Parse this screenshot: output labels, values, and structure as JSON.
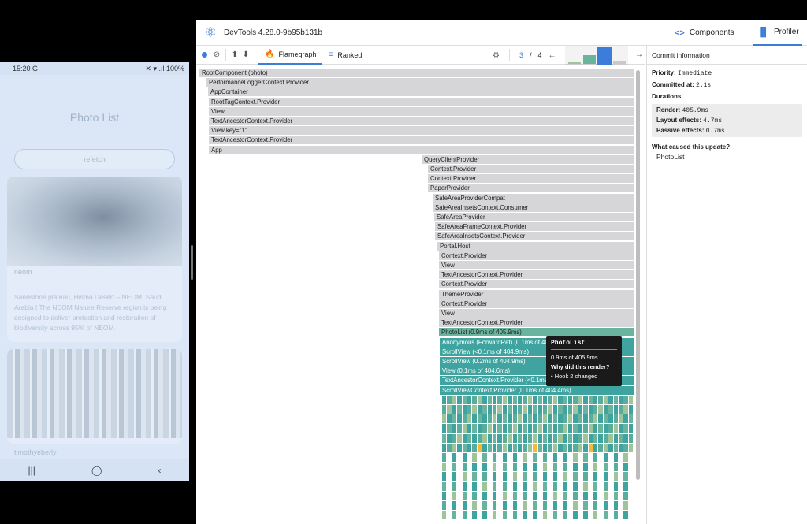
{
  "phone": {
    "status": {
      "time": "15:20",
      "time_icon": "G",
      "right": "✕ ▾ .ıl 100%"
    },
    "title": "Photo List",
    "refetch_label": "refetch",
    "cards": [
      {
        "user": "neom",
        "description": "Sandstone plateau, Hisma Desert – NEOM, Saudi Arabia | The NEOM Nature Reserve region is being designed to deliver protection and restoration of biodiversity across 95% of NEOM."
      },
      {
        "user": "timothyeberly",
        "description": ""
      }
    ],
    "nav": {
      "recents": "|||",
      "home": "◯",
      "back": "‹"
    }
  },
  "devtools": {
    "version": "DevTools 4.28.0-9b95b131b",
    "tabs": {
      "components": "Components",
      "profiler": "Profiler"
    },
    "icons": {
      "components": "<>",
      "profiler": "▐▌"
    },
    "toolbar": {
      "flamegraph": "Flamegraph",
      "ranked": "Ranked",
      "commit_current": "3",
      "commit_sep": "/",
      "commit_total": "4"
    },
    "commit_chart": {
      "commit_count": 4,
      "selected_commit": 3,
      "relative_heights": [
        0,
        0.5,
        0.9,
        0.15
      ],
      "colors": [
        "#9fc49a",
        "#6ab39e",
        "#3b7dd8",
        "#c9c9c9"
      ]
    },
    "flamegraph": [
      {
        "label": "RootComponent (photo)",
        "style": "grey"
      },
      {
        "label": "PerformanceLoggerContext.Provider",
        "style": "grey"
      },
      {
        "label": "AppContainer",
        "style": "grey"
      },
      {
        "label": "RootTagContext.Provider",
        "style": "grey"
      },
      {
        "label": "View",
        "style": "grey"
      },
      {
        "label": "TextAncestorContext.Provider",
        "style": "grey"
      },
      {
        "label": "View key=\"1\"",
        "style": "grey"
      },
      {
        "label": "TextAncestorContext.Provider",
        "style": "grey"
      },
      {
        "label": "App",
        "style": "grey"
      },
      {
        "label": "QueryClientProvider",
        "style": "grey"
      },
      {
        "label": "Context.Provider",
        "style": "grey"
      },
      {
        "label": "Context.Provider",
        "style": "grey"
      },
      {
        "label": "PaperProvider",
        "style": "grey"
      },
      {
        "label": "SafeAreaProviderCompat",
        "style": "grey"
      },
      {
        "label": "SafeAreaInsetsContext.Consumer",
        "style": "grey"
      },
      {
        "label": "SafeAreaProvider",
        "style": "grey"
      },
      {
        "label": "SafeAreaFrameContext.Provider",
        "style": "grey"
      },
      {
        "label": "SafeAreaInsetsContext.Provider",
        "style": "grey"
      },
      {
        "label": "Portal.Host",
        "style": "grey"
      },
      {
        "label": "Context.Provider",
        "style": "grey"
      },
      {
        "label": "View",
        "style": "grey"
      },
      {
        "label": "TextAncestorContext.Provider",
        "style": "grey"
      },
      {
        "label": "Context.Provider",
        "style": "grey"
      },
      {
        "label": "ThemeProvider",
        "style": "grey"
      },
      {
        "label": "Context.Provider",
        "style": "grey"
      },
      {
        "label": "View",
        "style": "grey"
      },
      {
        "label": "TextAncestorContext.Provider",
        "style": "grey"
      },
      {
        "label": "PhotoList (0.9ms of 405.9ms)",
        "style": "green"
      },
      {
        "label": "Anonymous (ForwardRef) (0.1ms of 405.0ms)",
        "style": "teal"
      },
      {
        "label": "ScrollView (<0.1ms of 404.9ms)",
        "style": "teal"
      },
      {
        "label": "ScrollView (0.2ms of 404.9ms)",
        "style": "teal"
      },
      {
        "label": "View (0.1ms of 404.6ms)",
        "style": "teal"
      },
      {
        "label": "TextAncestorContext.Provider (<0.1ms of 404.5ms)",
        "style": "teal"
      },
      {
        "label": "ScrollViewContext.Provider (0.1ms of 404.4ms)",
        "style": "teal"
      }
    ],
    "tooltip": {
      "name": "PhotoList",
      "time": "0.9ms of 405.9ms",
      "why": "Why did this render?",
      "reason": "• Hook 2 changed"
    },
    "sidebar": {
      "header": "Commit information",
      "priority_label": "Priority:",
      "priority_value": "Immediate",
      "committed_label": "Committed at:",
      "committed_value": "2.1s",
      "durations_label": "Durations",
      "render_label": "Render:",
      "render_value": "405.9ms",
      "layout_label": "Layout effects:",
      "layout_value": "4.7ms",
      "passive_label": "Passive effects:",
      "passive_value": "0.7ms",
      "cause_label": "What caused this update?",
      "cause_value": "PhotoList"
    }
  }
}
